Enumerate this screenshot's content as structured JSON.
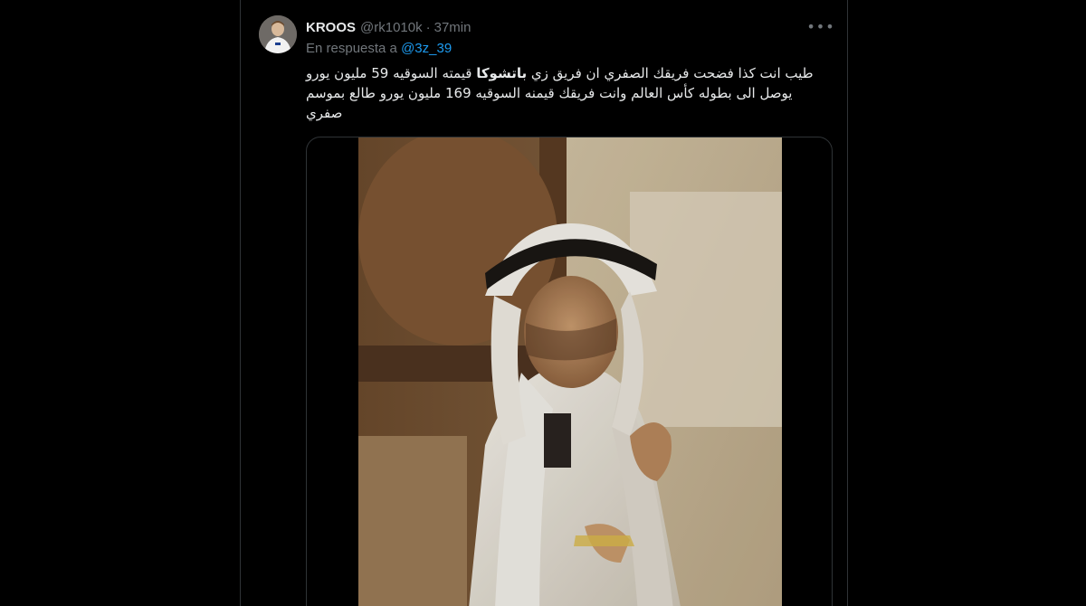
{
  "tweet": {
    "display_name": "KROOS",
    "handle": "@rk1010k",
    "dot": "·",
    "time": "37min",
    "reply_prefix": "En respuesta a",
    "reply_to": "@3z_39",
    "text_part1": "طيب انت كذا فضحت فريقك الصفري ان فريق زي ",
    "text_bold": "باتشوكا",
    "text_part2": " قيمته السوقيه 59 مليون يورو يوصل الى بطوله كأس العالم وانت فريقك قيمنه السوقيه 169 مليون يورو طالع بموسم صفري",
    "more_icon": "more-horizontal-icon"
  },
  "colors": {
    "background": "#000000",
    "text_primary": "#e7e9ea",
    "text_secondary": "#71767b",
    "link": "#1d9bf0",
    "border": "#2f3336"
  }
}
